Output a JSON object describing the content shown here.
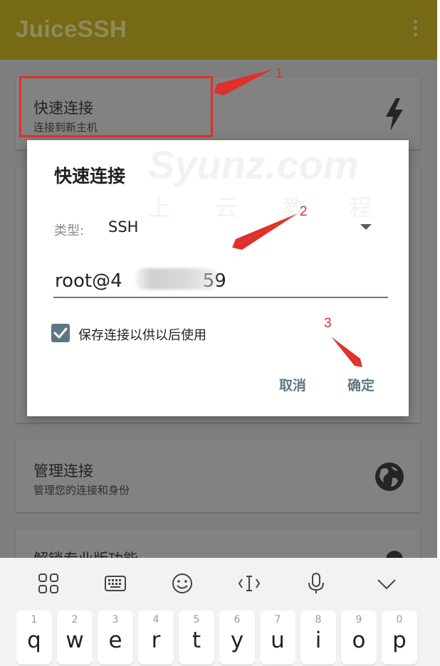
{
  "appbar": {
    "title": "JuiceSSH"
  },
  "cards": {
    "quick_connect": {
      "title": "快速连接",
      "subtitle": "连接到新主机"
    },
    "manage": {
      "title": "管理连接",
      "subtitle": "管理您的连接和身份"
    },
    "unlock": {
      "title": "解锁专业版功能"
    }
  },
  "dialog": {
    "title": "快速连接",
    "type_label": "类型:",
    "type_value": "SSH",
    "host_value_prefix": "root@4",
    "host_value_suffix": "59",
    "save_checkbox_label": "保存连接以供以后使用",
    "save_checked": true,
    "cancel_label": "取消",
    "ok_label": "确定"
  },
  "watermark": {
    "line1": "Syunz.com",
    "line2": "上云教程"
  },
  "annotations": {
    "n1": "1",
    "n2": "2",
    "n3": "3"
  },
  "keyboard": {
    "toolbar_icons": [
      "apps-grid-icon",
      "keyboard-icon",
      "emoji-icon",
      "cursor-move-icon",
      "microphone-icon",
      "collapse-chevron-icon"
    ],
    "keys": [
      {
        "num": "1",
        "char": "q"
      },
      {
        "num": "2",
        "char": "w"
      },
      {
        "num": "3",
        "char": "e"
      },
      {
        "num": "4",
        "char": "r"
      },
      {
        "num": "5",
        "char": "t"
      },
      {
        "num": "6",
        "char": "y"
      },
      {
        "num": "7",
        "char": "u"
      },
      {
        "num": "8",
        "char": "i"
      },
      {
        "num": "9",
        "char": "o"
      },
      {
        "num": "0",
        "char": "p"
      }
    ]
  },
  "colors": {
    "appbar_dim": "#766a17",
    "accent": "#5c7882",
    "annotation": "#e0302b"
  }
}
